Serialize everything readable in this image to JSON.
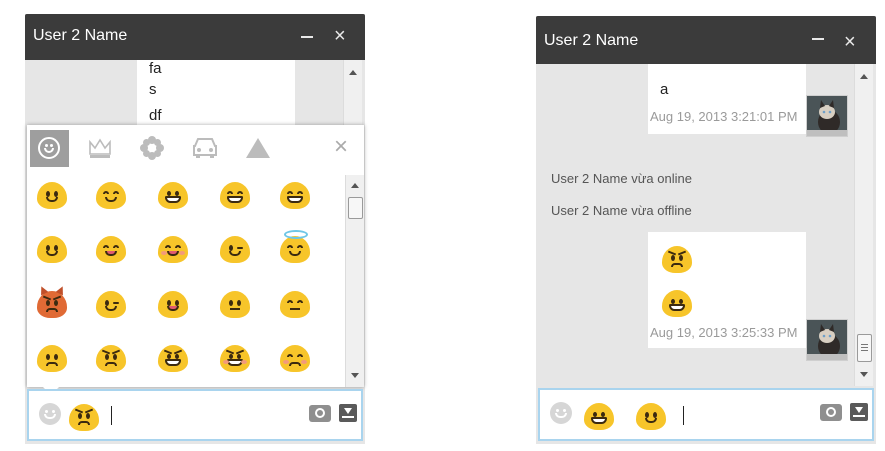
{
  "left_window": {
    "title": "User 2 Name",
    "messages": [
      "fa",
      "s",
      "df"
    ],
    "picker_tabs": [
      "smiley-icon",
      "crown-icon",
      "flower-icon",
      "car-icon",
      "triangle-icon"
    ],
    "picker_close": "×",
    "emoji_rows": [
      [
        "smile",
        "happy",
        "grin",
        "grin-happy",
        "grin-squint"
      ],
      [
        "smile",
        "laugh",
        "blush-laugh",
        "wink-smile",
        "halo"
      ],
      [
        "devil",
        "wink",
        "tongue",
        "neutral",
        "expressionless"
      ],
      [
        "confused",
        "angry",
        "grimace",
        "angry-blush",
        "sad-tired"
      ]
    ],
    "input_emoji": [
      "angry"
    ]
  },
  "right_window": {
    "title": "User 2 Name",
    "msg1_text": "a",
    "msg1_ts": "Aug 19, 2013 3:21:01 PM",
    "sys1": "User 2 Name vừa online",
    "sys2": "User 2 Name vừa offline",
    "msg2_ts": "Aug 19, 2013 3:25:33 PM",
    "input_emoji": [
      "grin",
      "smile"
    ]
  },
  "window_controls": {
    "close": "×"
  }
}
